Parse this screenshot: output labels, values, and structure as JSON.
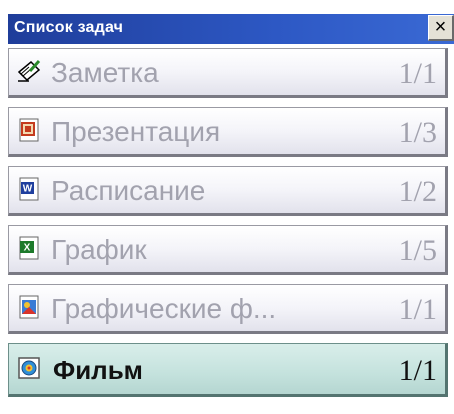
{
  "window": {
    "title": "Список задач",
    "close_label": "×"
  },
  "tasks": [
    {
      "label": "Заметка",
      "count": "1/1",
      "icon": "note-icon",
      "active": false
    },
    {
      "label": "Презентация",
      "count": "1/3",
      "icon": "presentation-icon",
      "active": false
    },
    {
      "label": "Расписание",
      "count": "1/2",
      "icon": "word-document-icon",
      "active": false
    },
    {
      "label": "График",
      "count": "1/5",
      "icon": "spreadsheet-icon",
      "active": false
    },
    {
      "label": "Графические ф...",
      "count": "1/1",
      "icon": "image-file-icon",
      "active": false
    },
    {
      "label": "Фильм",
      "count": "1/1",
      "icon": "movie-icon",
      "active": true
    }
  ],
  "colors": {
    "titlebar": "#2d58c4",
    "active_item": "#c4e2dd",
    "inactive_text": "#a2a2ae",
    "active_text": "#111111"
  }
}
